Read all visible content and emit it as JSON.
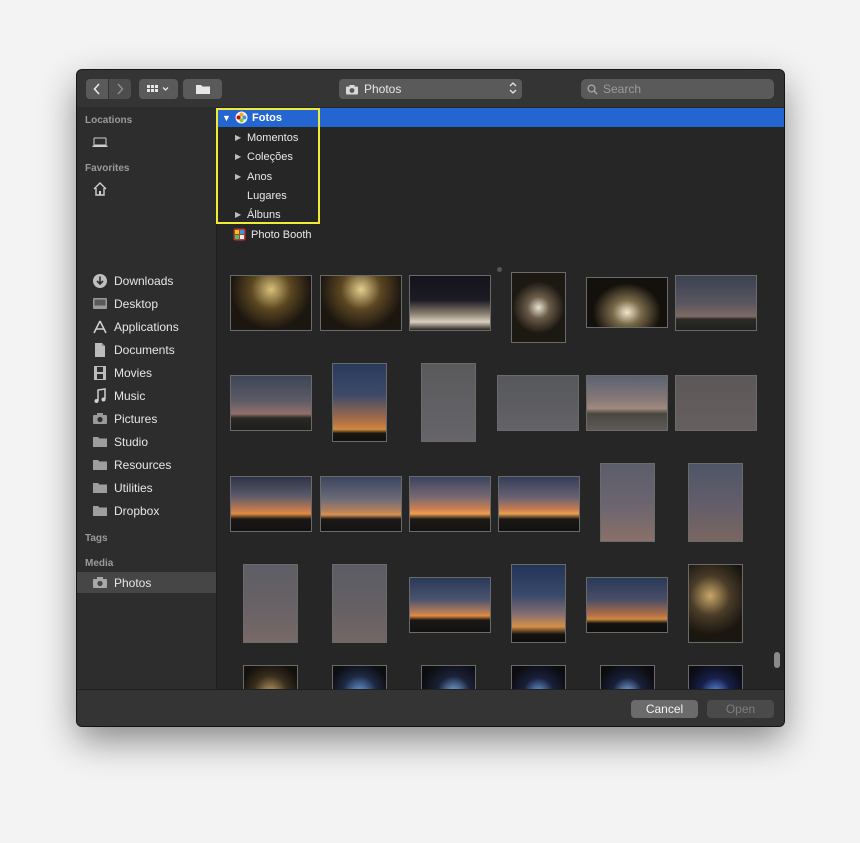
{
  "toolbar": {
    "location": "Photos",
    "search_placeholder": "Search"
  },
  "sidebar": {
    "sections": {
      "locations": "Locations",
      "favorites": "Favorites",
      "tags": "Tags",
      "media": "Media"
    },
    "favorites": [
      {
        "label": "Downloads",
        "icon": "downloads-icon"
      },
      {
        "label": "Desktop",
        "icon": "desktop-icon"
      },
      {
        "label": "Applications",
        "icon": "applications-icon"
      },
      {
        "label": "Documents",
        "icon": "documents-icon"
      },
      {
        "label": "Movies",
        "icon": "movies-icon"
      },
      {
        "label": "Music",
        "icon": "music-icon"
      },
      {
        "label": "Pictures",
        "icon": "pictures-icon"
      },
      {
        "label": "Studio",
        "icon": "folder-icon"
      },
      {
        "label": "Resources",
        "icon": "folder-icon"
      },
      {
        "label": "Utilities",
        "icon": "folder-icon"
      },
      {
        "label": "Dropbox",
        "icon": "folder-icon"
      }
    ],
    "media": [
      {
        "label": "Photos",
        "icon": "camera-icon",
        "selected": true
      }
    ]
  },
  "tree": {
    "root": "Fotos",
    "children": [
      {
        "label": "Momentos",
        "expandable": true
      },
      {
        "label": "Coleções",
        "expandable": true
      },
      {
        "label": "Anos",
        "expandable": true
      },
      {
        "label": "Lugares",
        "expandable": false
      },
      {
        "label": "Álbuns",
        "expandable": true
      }
    ],
    "photo_booth": "Photo Booth"
  },
  "footer": {
    "cancel": "Cancel",
    "open": "Open"
  },
  "colors": {
    "selection": "#2366d1",
    "highlight_box": "#f1ea3a"
  }
}
